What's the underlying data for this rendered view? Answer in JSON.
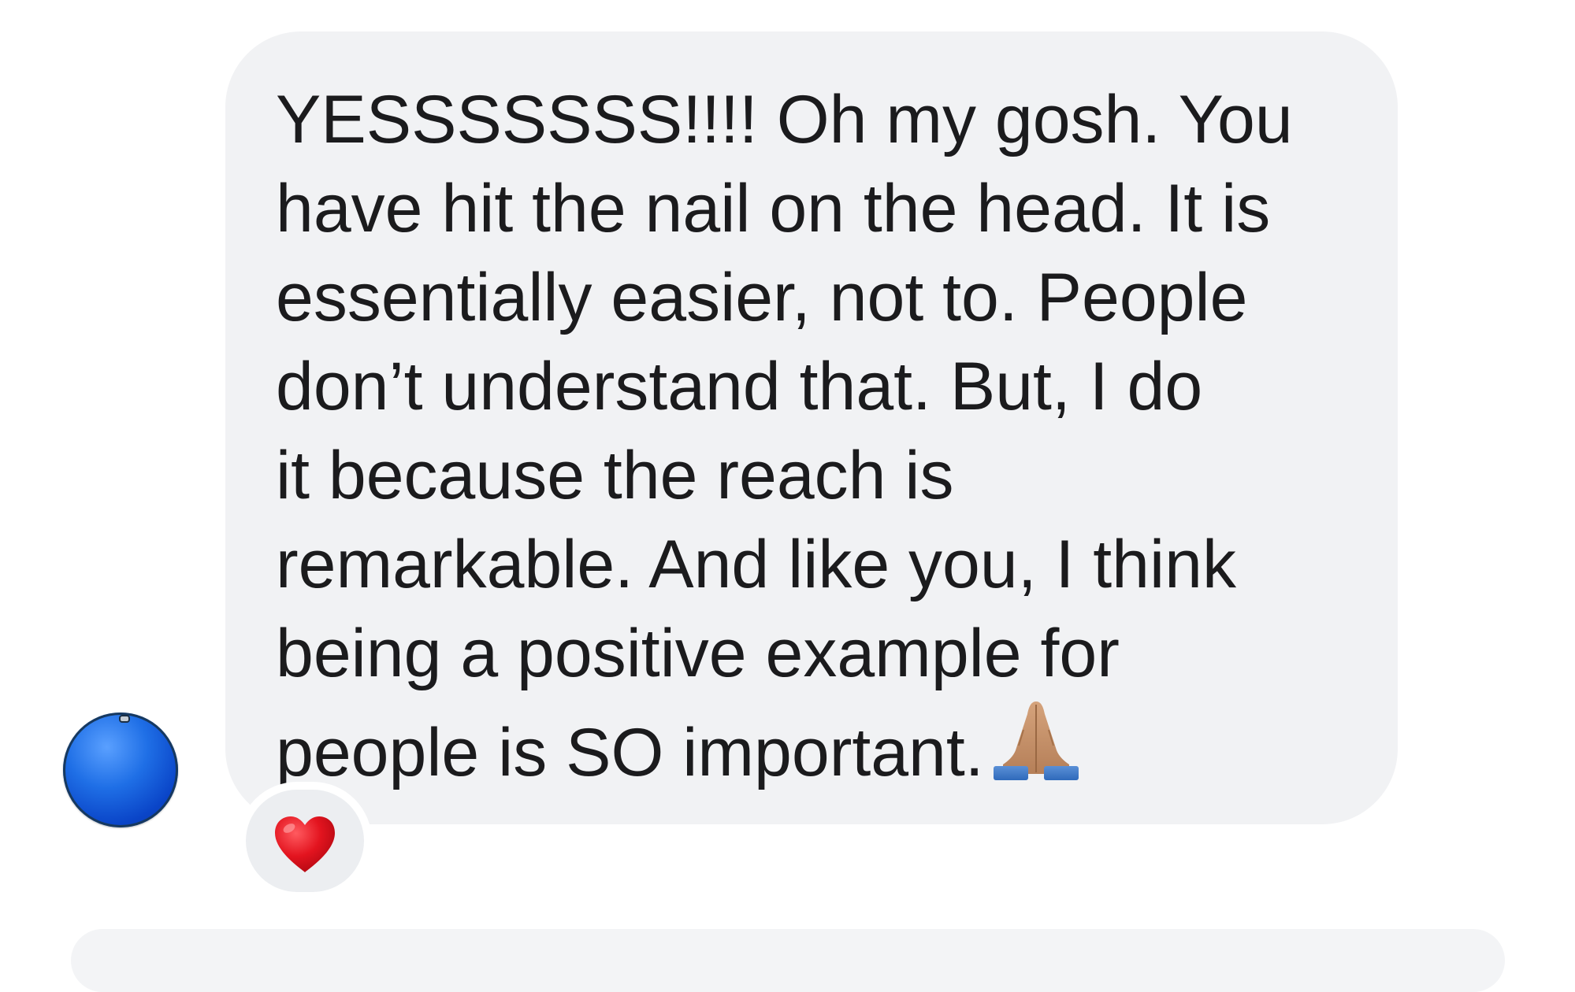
{
  "message": {
    "lines": [
      "YESSSSSSS!!!! Oh my gosh. You",
      "have hit the nail on the head. It is",
      "essentially easier, not to. People",
      "don’t understand that. But, I do",
      "it because the reach is",
      "remarkable. And like you, I think",
      "being a positive example for",
      "people is SO important."
    ],
    "emoji": "folded-hands-emoji",
    "bubble_color": "#f1f2f4",
    "text_color": "#1b1b1d"
  },
  "reaction": {
    "emoji": "red-heart-emoji",
    "color": "#e11d2b"
  },
  "avatar": {
    "icon": "blue-circle-avatar",
    "color": "#0a45c8"
  }
}
